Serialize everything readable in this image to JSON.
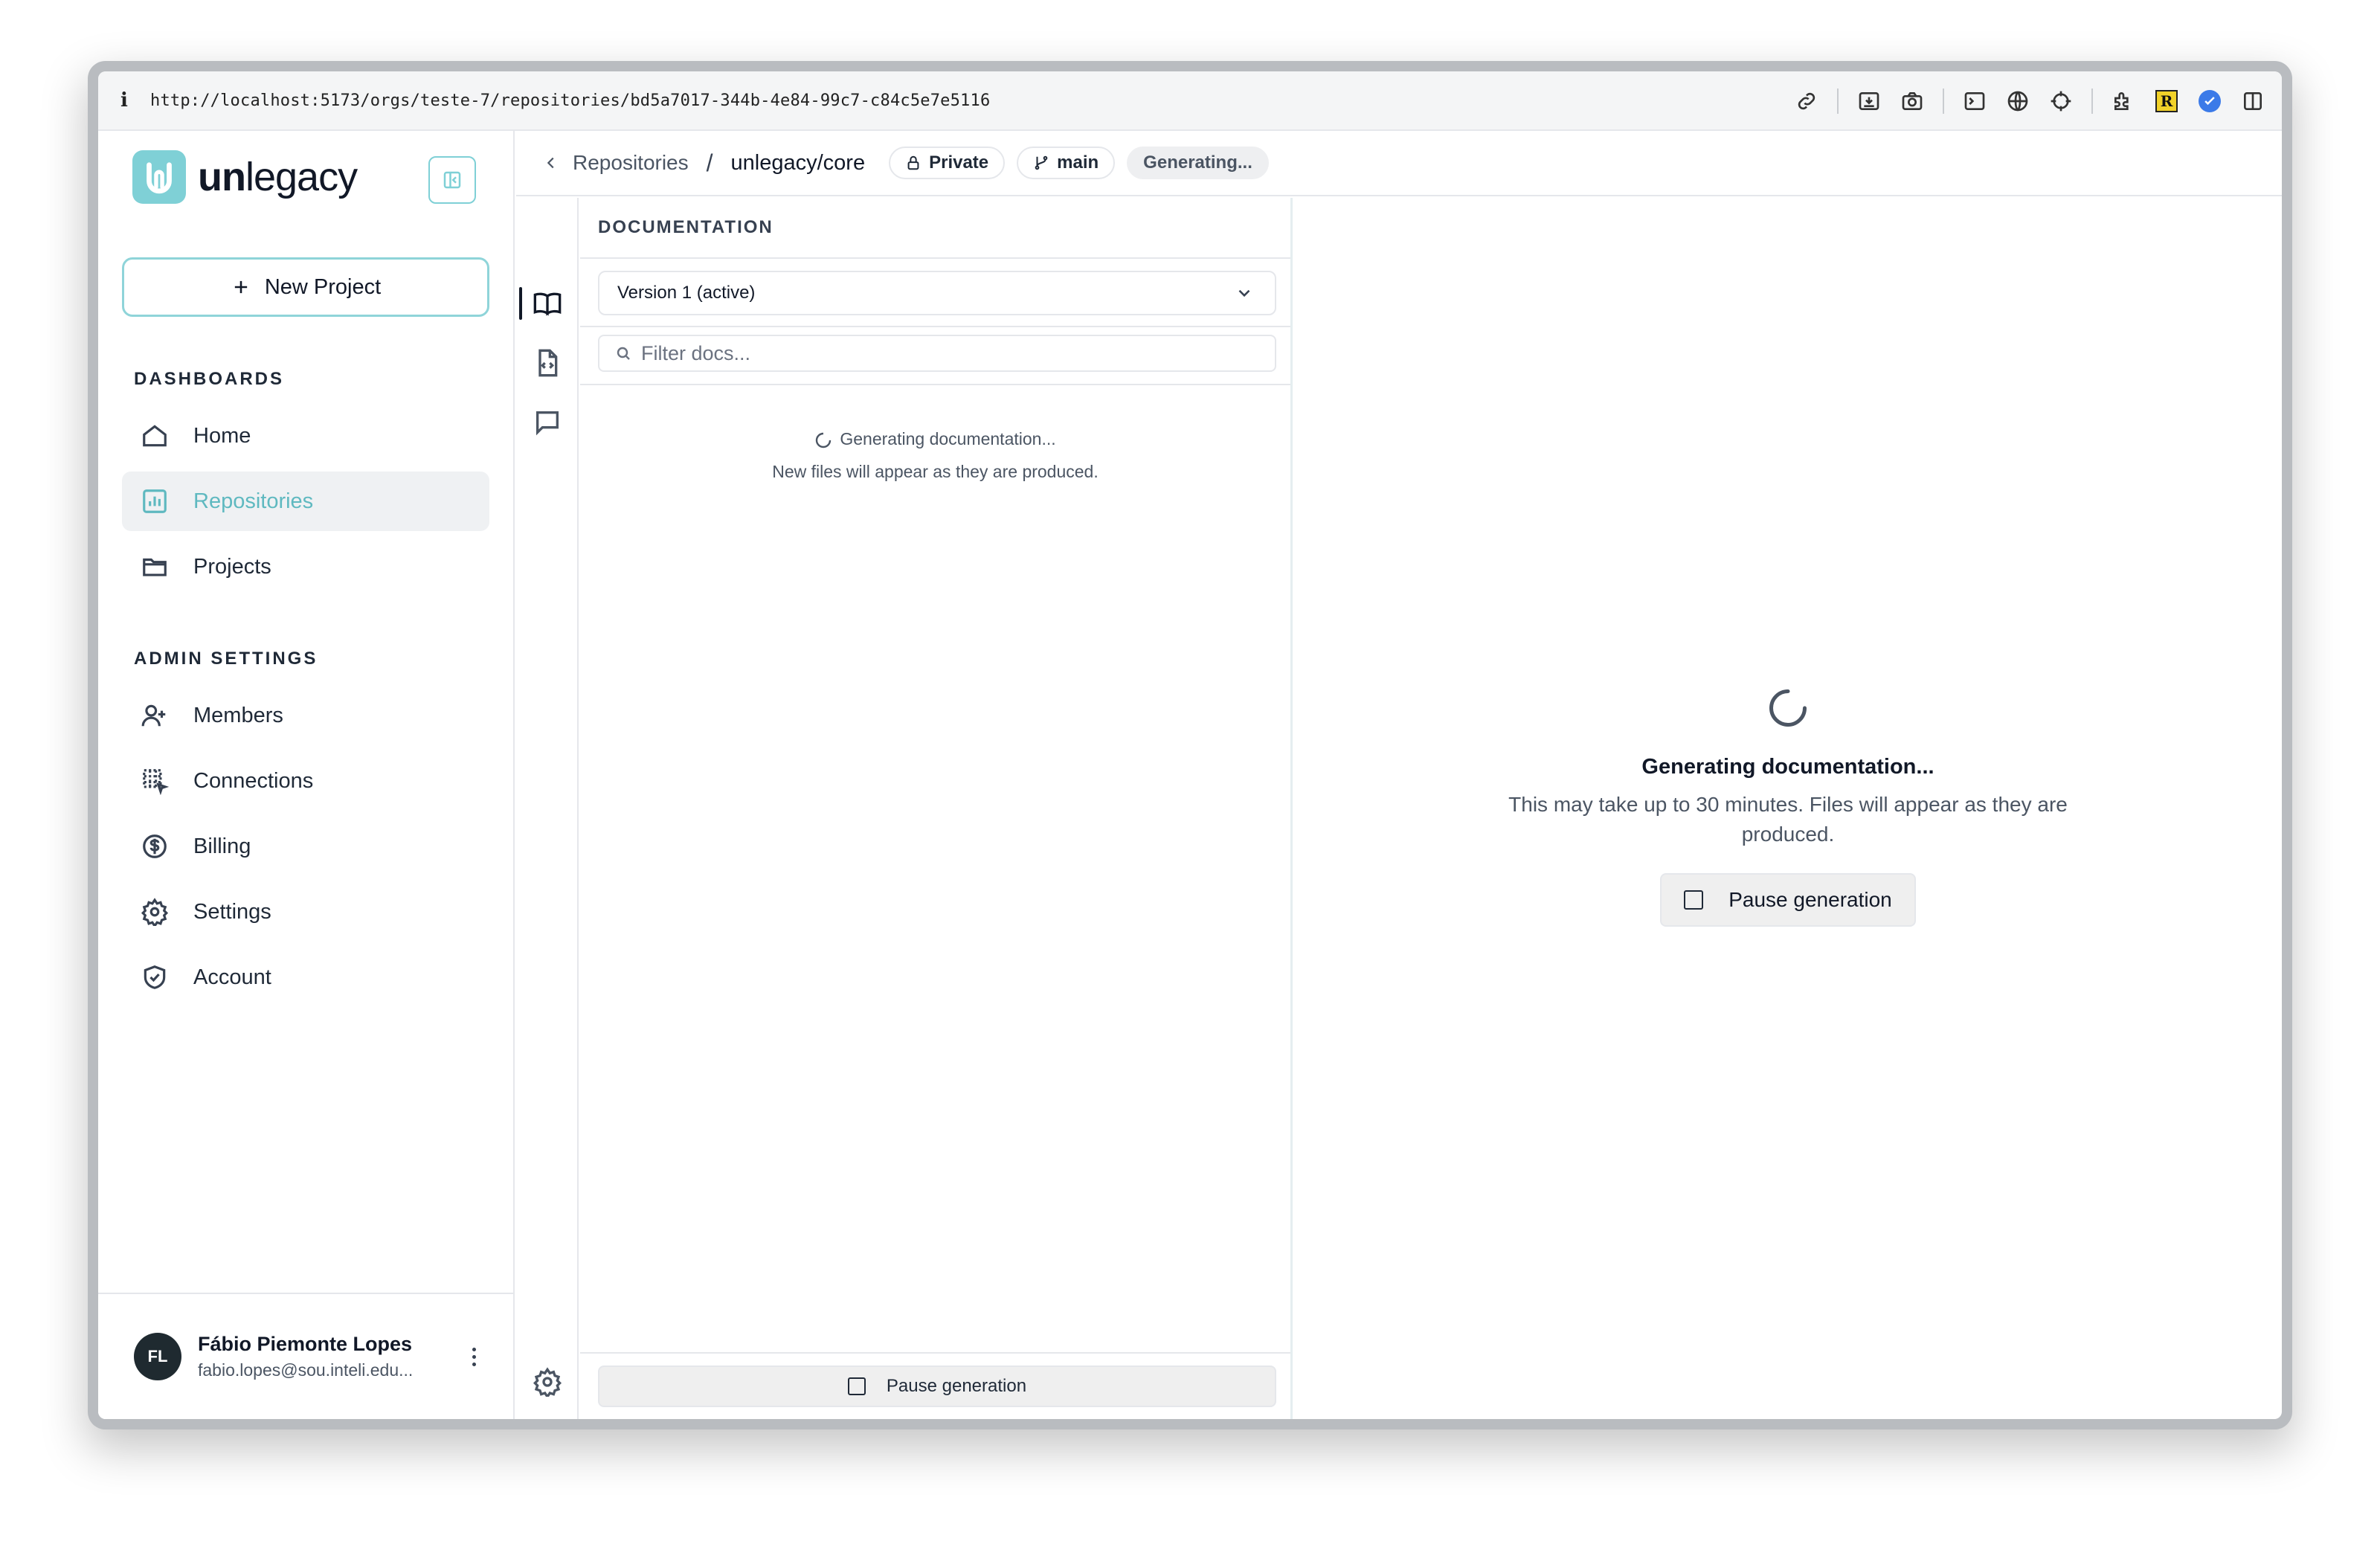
{
  "browser": {
    "info_glyph": "i",
    "url": "http://localhost:5173/orgs/teste-7/repositories/bd5a7017-344b-4e84-99c7-c84c5e7e5116",
    "extension_badge": "R"
  },
  "brand": {
    "name_bold": "un",
    "name_rest": "legacy",
    "color": "#7fd0d6"
  },
  "sidebar": {
    "new_project_label": "New Project",
    "dashboards_title": "DASHBOARDS",
    "dashboards": [
      {
        "label": "Home",
        "icon": "home-icon"
      },
      {
        "label": "Repositories",
        "icon": "chart-icon",
        "active": true
      },
      {
        "label": "Projects",
        "icon": "folder-icon"
      }
    ],
    "admin_title": "ADMIN SETTINGS",
    "admin": [
      {
        "label": "Members",
        "icon": "user-plus-icon"
      },
      {
        "label": "Connections",
        "icon": "grid-pointer-icon"
      },
      {
        "label": "Billing",
        "icon": "dollar-circle-icon"
      },
      {
        "label": "Settings",
        "icon": "gear-icon"
      },
      {
        "label": "Account",
        "icon": "shield-check-icon"
      }
    ],
    "user": {
      "initials": "FL",
      "name": "Fábio Piemonte Lopes",
      "email": "fabio.lopes@sou.inteli.edu..."
    }
  },
  "topbar": {
    "back_label": "Repositories",
    "separator": "/",
    "current": "unlegacy/core",
    "visibility": "Private",
    "branch": "main",
    "status": "Generating..."
  },
  "docs": {
    "header": "DOCUMENTATION",
    "version": "Version 1 (active)",
    "filter_placeholder": "Filter docs...",
    "status_line1": "Generating documentation...",
    "status_line2": "New files will appear as they are produced.",
    "pause_label": "Pause generation"
  },
  "main": {
    "title": "Generating documentation...",
    "subtitle": "This may take up to 30 minutes. Files will appear as they are produced.",
    "pause_label": "Pause generation"
  }
}
